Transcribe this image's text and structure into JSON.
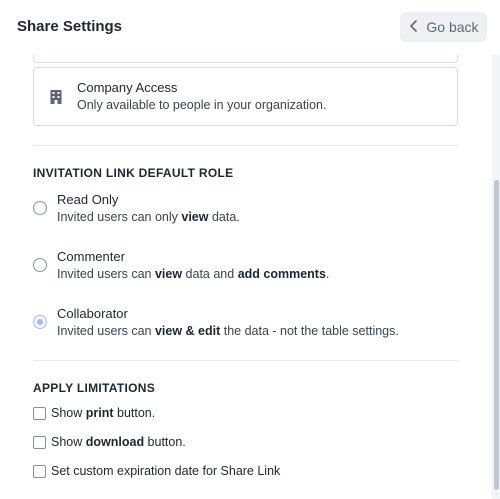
{
  "header": {
    "title": "Share Settings",
    "back_label": "Go back"
  },
  "company_access": {
    "title": "Company Access",
    "description": "Only available to people in your organization."
  },
  "invitation": {
    "heading": "INVITATION LINK DEFAULT ROLE",
    "options": [
      {
        "title": "Read Only",
        "desc_pre": "Invited users can only ",
        "desc_b1": "view",
        "desc_mid": " data.",
        "desc_b2": "",
        "desc_post": "",
        "selected": false
      },
      {
        "title": "Commenter",
        "desc_pre": "Invited users can ",
        "desc_b1": "view",
        "desc_mid": " data and ",
        "desc_b2": "add comments",
        "desc_post": ".",
        "selected": false
      },
      {
        "title": "Collaborator",
        "desc_pre": "Invited users can ",
        "desc_b1": "view & edit",
        "desc_mid": " the data - not the table settings.",
        "desc_b2": "",
        "desc_post": "",
        "selected": true
      }
    ]
  },
  "limitations": {
    "heading": "APPLY LIMITATIONS",
    "items": [
      {
        "pre": "Show ",
        "bold": "print",
        "post": " button.",
        "checked": false
      },
      {
        "pre": "Show ",
        "bold": "download",
        "post": " button.",
        "checked": false
      },
      {
        "pre": "Set custom expiration date for Share Link",
        "bold": "",
        "post": "",
        "checked": false
      }
    ]
  },
  "icons": {
    "back": "chevron-left-icon",
    "company": "building-icon"
  },
  "colors": {
    "accent": "#aab8ee",
    "border": "#d9dce2",
    "button_bg": "#eef0f4"
  }
}
